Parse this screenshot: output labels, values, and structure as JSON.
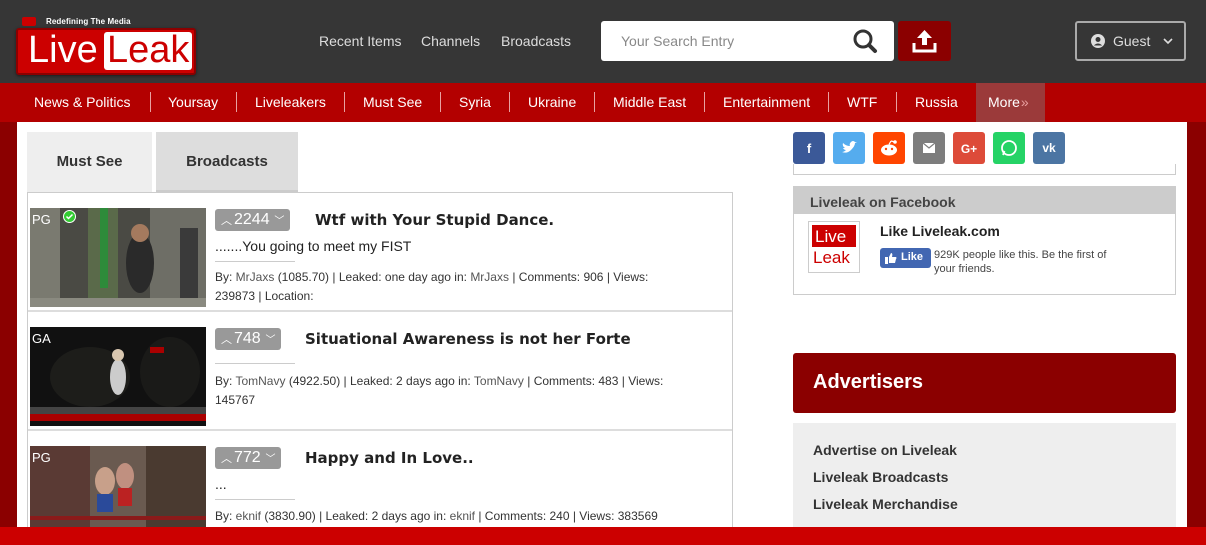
{
  "header": {
    "tagline": "Redefining The Media",
    "logo_live": "Live",
    "logo_leak": "Leak",
    "nav": [
      "Recent Items",
      "Channels",
      "Broadcasts"
    ],
    "search_placeholder": "Your Search Entry",
    "user_label": "Guest"
  },
  "categories": [
    "News & Politics",
    "Yoursay",
    "Liveleakers",
    "Must See",
    "Syria",
    "Ukraine",
    "Middle East",
    "Entertainment",
    "WTF",
    "Russia",
    "More"
  ],
  "more_chevron": "»",
  "tabs": [
    "Must See",
    "Broadcasts"
  ],
  "items": [
    {
      "rating": "PG",
      "votes": "2244",
      "title": "Wtf with Your Stupid Dance.",
      "description": ".......You going to meet my FIST",
      "by_label": "By: ",
      "user": "MrJaxs",
      "score": "(1085.70)",
      "leaked": "| Leaked: one day ago in:",
      "channel": "MrJaxs",
      "stats": "| Comments: 906 | Views:",
      "line2": "239873 | Location:"
    },
    {
      "rating": "GA",
      "votes": "748",
      "title": "Situational Awareness is not her Forte",
      "description": "",
      "by_label": "By: ",
      "user": "TomNavy",
      "score": "(4922.50)",
      "leaked": "| Leaked: 2 days ago in:",
      "channel": "TomNavy",
      "stats": "| Comments: 483 | Views:",
      "line2": "145767"
    },
    {
      "rating": "PG",
      "votes": "772",
      "title": "Happy and In Love..",
      "description": "...",
      "by_label": "By: ",
      "user": "eknif",
      "score": "(3830.90)",
      "leaked": "| Leaked: 2 days ago in:",
      "channel": "eknif",
      "stats": "| Comments: 240 | Views: 383569",
      "line2": ""
    }
  ],
  "share": [
    {
      "name": "facebook",
      "glyph": "f",
      "color": "#3b5998"
    },
    {
      "name": "twitter",
      "glyph": "t",
      "color": "#55acee"
    },
    {
      "name": "reddit",
      "glyph": "r",
      "color": "#ff4500"
    },
    {
      "name": "email",
      "glyph": "✉",
      "color": "#7d7d7d"
    },
    {
      "name": "google-plus",
      "glyph": "G+",
      "color": "#dd4b39"
    },
    {
      "name": "whatsapp",
      "glyph": "w",
      "color": "#25d366"
    },
    {
      "name": "vk",
      "glyph": "vk",
      "color": "#4c75a3"
    }
  ],
  "facebook_box": {
    "heading": "Liveleak on Facebook",
    "like_title": "Like Liveleak.com",
    "like_button": "Like",
    "like_text": "929K people like this. Be the first of your friends.",
    "logo_live": "Live",
    "logo_leak": "Leak"
  },
  "advertisers": {
    "title": "Advertisers",
    "links": [
      "Advertise on Liveleak",
      "Liveleak Broadcasts",
      "Liveleak Merchandise"
    ]
  }
}
